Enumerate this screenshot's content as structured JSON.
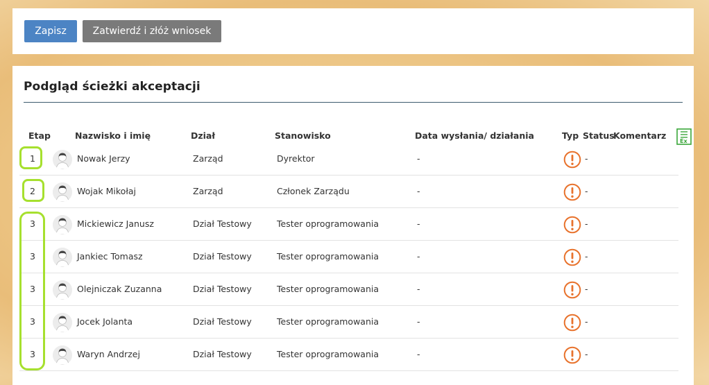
{
  "toolbar": {
    "save_label": "Zapisz",
    "submit_label": "Zatwierdź i złóż wniosek",
    "save_color": "#4c84c4",
    "submit_color": "#7a7a7a"
  },
  "panel": {
    "title": "Podgląd ścieżki akceptacji",
    "export_icon": "excel-export-icon"
  },
  "table": {
    "columns": {
      "stage": "Etap",
      "name": "Nazwisko i imię",
      "department": "Dział",
      "position": "Stanowisko",
      "date": "Data wysłania/ działania",
      "type": "Typ",
      "status": "Status",
      "comment": "Komentarz"
    },
    "rows": [
      {
        "stage": "1",
        "name": "Nowak Jerzy",
        "department": "Zarząd",
        "position": "Dyrektor",
        "date": "-",
        "status": "-"
      },
      {
        "stage": "2",
        "name": "Wojak Mikołaj",
        "department": "Zarząd",
        "position": "Członek Zarządu",
        "date": "-",
        "status": "-"
      },
      {
        "stage": "3",
        "name": "Mickiewicz Janusz",
        "department": "Dział Testowy",
        "position": "Tester oprogramowania",
        "date": "-",
        "status": "-"
      },
      {
        "stage": "3",
        "name": "Jankiec Tomasz",
        "department": "Dział Testowy",
        "position": "Tester oprogramowania",
        "date": "-",
        "status": "-"
      },
      {
        "stage": "3",
        "name": "Olejniczak Zuzanna",
        "department": "Dział Testowy",
        "position": "Tester oprogramowania",
        "date": "-",
        "status": "-"
      },
      {
        "stage": "3",
        "name": "Jocek Jolanta",
        "department": "Dział Testowy",
        "position": "Tester oprogramowania",
        "date": "-",
        "status": "-"
      },
      {
        "stage": "3",
        "name": "Waryn Andrzej",
        "department": "Dział Testowy",
        "position": "Tester oprogramowania",
        "date": "-",
        "status": "-"
      }
    ],
    "type_icon": "warning-circle-icon",
    "type_icon_color": "#e8722c",
    "highlight_color": "#a6e02e"
  }
}
